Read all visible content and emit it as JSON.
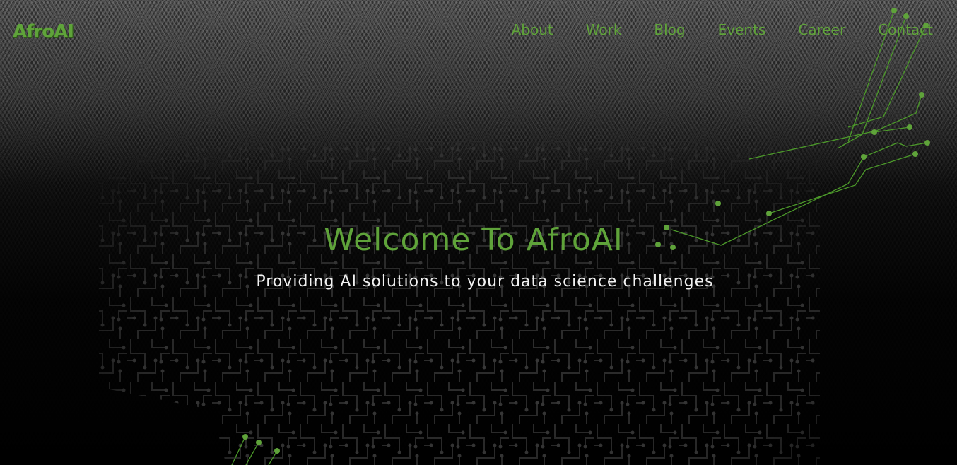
{
  "brand": {
    "logo_text": "AfroAI",
    "accent_color": "#5fa33a"
  },
  "nav": {
    "items": [
      {
        "label": "About"
      },
      {
        "label": "Work"
      },
      {
        "label": "Blog"
      },
      {
        "label": "Events"
      },
      {
        "label": "Career"
      },
      {
        "label": "Contact"
      }
    ]
  },
  "hero": {
    "title": "Welcome To AfroAI",
    "subtitle": "Providing AI solutions to your data science challenges"
  },
  "background": {
    "icon": "circuit-board-pattern",
    "texture": "chevron-pattern"
  }
}
